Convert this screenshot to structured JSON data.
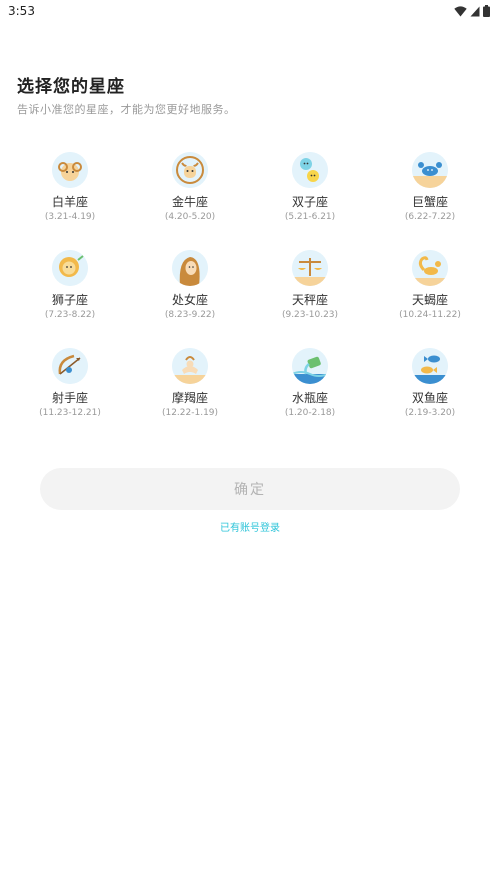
{
  "status_bar": {
    "time": "3:53"
  },
  "header": {
    "title": "选择您的星座",
    "subtitle": "告诉小准您的星座，才能为您更好地服务。"
  },
  "zodiac": [
    {
      "name": "白羊座",
      "range": "(3.21-4.19)",
      "icon": "aries-icon"
    },
    {
      "name": "金牛座",
      "range": "(4.20-5.20)",
      "icon": "taurus-icon"
    },
    {
      "name": "双子座",
      "range": "(5.21-6.21)",
      "icon": "gemini-icon"
    },
    {
      "name": "巨蟹座",
      "range": "(6.22-7.22)",
      "icon": "cancer-icon"
    },
    {
      "name": "狮子座",
      "range": "(7.23-8.22)",
      "icon": "leo-icon"
    },
    {
      "name": "处女座",
      "range": "(8.23-9.22)",
      "icon": "virgo-icon"
    },
    {
      "name": "天秤座",
      "range": "(9.23-10.23)",
      "icon": "libra-icon"
    },
    {
      "name": "天蝎座",
      "range": "(10.24-11.22)",
      "icon": "scorpio-icon"
    },
    {
      "name": "射手座",
      "range": "(11.23-12.21)",
      "icon": "sagittarius-icon"
    },
    {
      "name": "摩羯座",
      "range": "(12.22-1.19)",
      "icon": "capricorn-icon"
    },
    {
      "name": "水瓶座",
      "range": "(1.20-2.18)",
      "icon": "aquarius-icon"
    },
    {
      "name": "双鱼座",
      "range": "(2.19-3.20)",
      "icon": "pisces-icon"
    }
  ],
  "confirm_label": "确定",
  "login_link": "已有账号登录",
  "colors": {
    "accent": "#2ec4d9",
    "icon_bg": "#e3f3fb",
    "button_bg": "#f3f3f3"
  }
}
